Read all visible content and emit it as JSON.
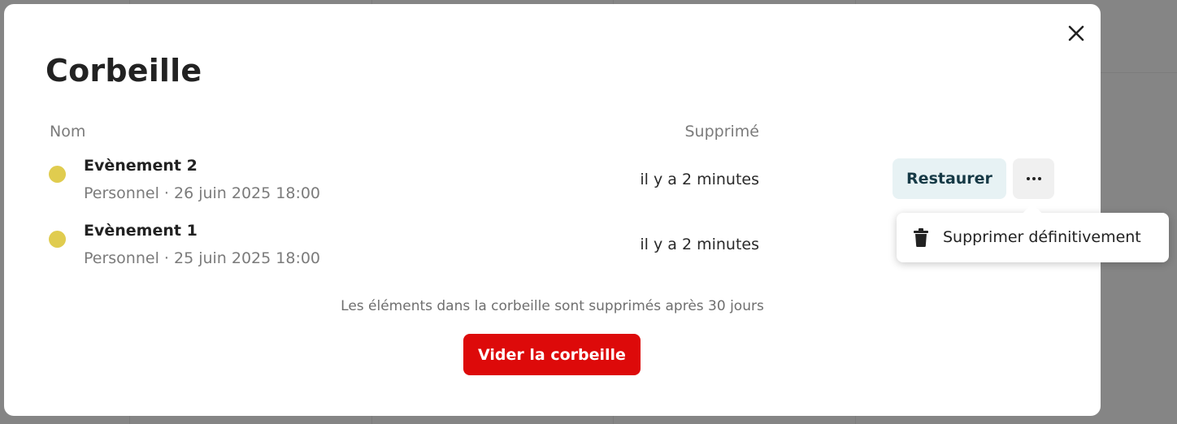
{
  "modal": {
    "title": "Corbeille",
    "close_icon": "close-icon"
  },
  "table": {
    "columns": {
      "name": "Nom",
      "deleted": "Supprimé"
    },
    "rows": [
      {
        "title": "Evènement 2",
        "meta": "Personnel · 26 juin 2025 18:00",
        "deleted": "il y a 2 minutes",
        "color": "#e0cc4f"
      },
      {
        "title": "Evènement 1",
        "meta": "Personnel · 25 juin 2025 18:00",
        "deleted": "il y a 2 minutes",
        "color": "#e0cc4f"
      }
    ]
  },
  "actions": {
    "restore_label": "Restaurer",
    "more_icon": "ellipsis-icon"
  },
  "menu": {
    "items": [
      {
        "label": "Supprimer définitivement",
        "icon": "trash-icon"
      }
    ]
  },
  "footer": {
    "note": "Les éléments dans la corbeille sont supprimés après 30 jours",
    "empty_label": "Vider la corbeille"
  },
  "colors": {
    "danger": "#dd0a0a",
    "restore_bg": "#e7f2f4",
    "restore_text": "#163a46",
    "backdrop": "#858585"
  }
}
